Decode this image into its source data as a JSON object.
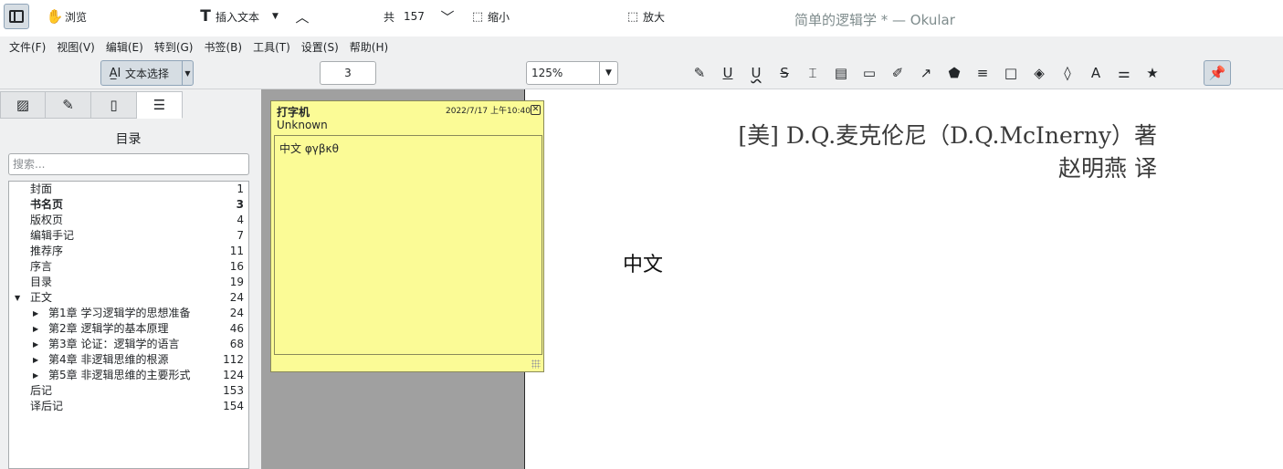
{
  "window": {
    "title": "简单的逻辑学 * — Okular"
  },
  "menubar": [
    "文件(F)",
    "视图(V)",
    "编辑(E)",
    "转到(G)",
    "书签(B)",
    "工具(T)",
    "设置(S)",
    "帮助(H)"
  ],
  "toolbar": {
    "browse_label": "浏览",
    "text_select_label": "文本选择",
    "insert_text_label": "插入文本",
    "page_value": "3",
    "total_prefix": "共",
    "total_pages": "157",
    "zoom_out_label": "缩小",
    "zoom_value": "125%",
    "zoom_in_label": "放大"
  },
  "sidebar": {
    "panel_title": "目录",
    "search_placeholder": "搜索...",
    "toc": [
      {
        "label": "封面",
        "page": "1",
        "level": 0,
        "bold": false
      },
      {
        "label": "书名页",
        "page": "3",
        "level": 0,
        "bold": true
      },
      {
        "label": "版权页",
        "page": "4",
        "level": 0,
        "bold": false
      },
      {
        "label": "编辑手记",
        "page": "7",
        "level": 0,
        "bold": false
      },
      {
        "label": "推荐序",
        "page": "11",
        "level": 0,
        "bold": false
      },
      {
        "label": "序言",
        "page": "16",
        "level": 0,
        "bold": false
      },
      {
        "label": "目录",
        "page": "19",
        "level": 0,
        "bold": false
      },
      {
        "label": "正文",
        "page": "24",
        "level": 0,
        "bold": false,
        "expanded": true
      },
      {
        "label": "第1章  学习逻辑学的思想准备",
        "page": "24",
        "level": 1,
        "bold": false
      },
      {
        "label": "第2章  逻辑学的基本原理",
        "page": "46",
        "level": 1,
        "bold": false
      },
      {
        "label": "第3章  论证：逻辑学的语言",
        "page": "68",
        "level": 1,
        "bold": false
      },
      {
        "label": "第4章  非逻辑思维的根源",
        "page": "112",
        "level": 1,
        "bold": false
      },
      {
        "label": "第5章  非逻辑思维的主要形式",
        "page": "124",
        "level": 1,
        "bold": false
      },
      {
        "label": "后记",
        "page": "153",
        "level": 0,
        "bold": false
      },
      {
        "label": "译后记",
        "page": "154",
        "level": 0,
        "bold": false
      }
    ]
  },
  "note": {
    "title": "打字机",
    "author": "Unknown",
    "date": "2022/7/17 上午10:40",
    "body": "中文 φγβκθ"
  },
  "page": {
    "author_line": "[美] D.Q.麦克伦尼（D.Q.McInerny）著",
    "translator_line": "赵明燕 译",
    "typed_text": "中文"
  }
}
